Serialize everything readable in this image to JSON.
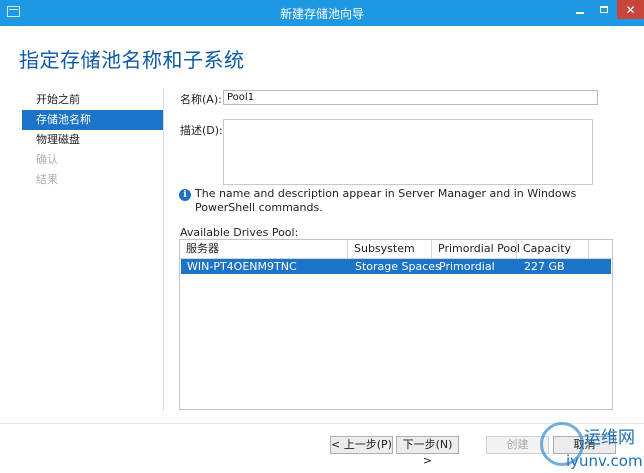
{
  "window": {
    "title": "新建存储池向导",
    "controls": {
      "minimize": "minimize-icon",
      "maximize": "maximize-icon",
      "close": "close-icon"
    }
  },
  "page_title": "指定存储池名称和子系统",
  "nav": {
    "items": [
      {
        "label": "开始之前",
        "state": "normal"
      },
      {
        "label": "存储池名称",
        "state": "selected"
      },
      {
        "label": "物理磁盘",
        "state": "normal"
      },
      {
        "label": "确认",
        "state": "disabled"
      },
      {
        "label": "结果",
        "state": "disabled"
      }
    ]
  },
  "form": {
    "name_label": "名称(A):",
    "name_value": "Pool1",
    "description_label": "描述(D):",
    "description_value": "",
    "info_text": "The name and description appear in Server Manager and in Windows PowerShell commands."
  },
  "drives": {
    "label": "Available Drives Pool:",
    "columns": [
      "服务器",
      "Subsystem",
      "Primordial Pool",
      "Capacity"
    ],
    "rows": [
      {
        "server": "WIN-PT4OENM9TNC",
        "subsystem": "Storage Spaces",
        "pool": "Primordial",
        "capacity": "227 GB",
        "selected": true
      }
    ]
  },
  "buttons": {
    "prev": "< 上一步(P)",
    "next": "下一步(N) >",
    "create": "创建",
    "cancel": "取消"
  },
  "watermark": {
    "line1": "运维网",
    "line2": "iyunv.com"
  },
  "colors": {
    "titlebar": "#1e98e2",
    "close_button": "#c7453b",
    "selection": "#1b74c7",
    "heading": "#0e5aa8"
  }
}
